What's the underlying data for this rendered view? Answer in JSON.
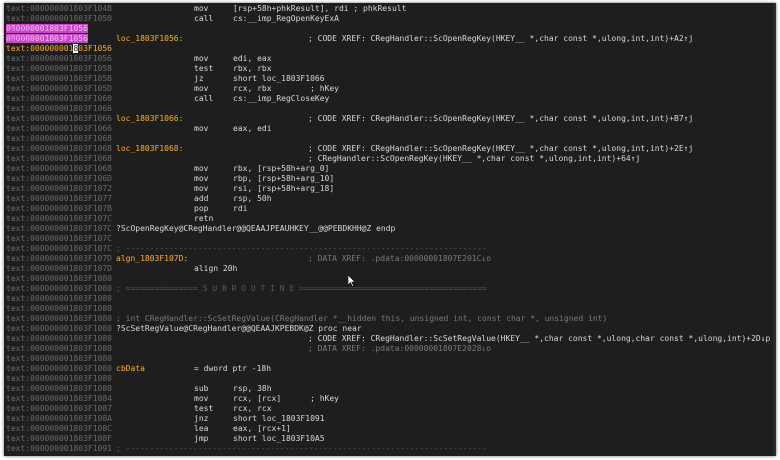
{
  "lines": [
    {
      "addr": "text:000000001803F104B",
      "mnem": "mov",
      "ops": "[rsp+58h+phkResult], rdi ; phkResult"
    },
    {
      "addr": "text:000000001803F1050",
      "mnem": "call",
      "ops": "cs:__imp_RegOpenKeyExA"
    },
    {
      "addr": "text:000000001803F1056",
      "addr_style": "hl"
    },
    {
      "addr": "text:000000001803F1056",
      "addr_style": "hl",
      "label": "loc_1803F1056:",
      "cmt": "; CODE XREF: CRegHandler::ScOpenRegKey(HKEY__ *,char const *,ulong,int,int)+A2↑j"
    },
    {
      "addr": "text:000000001803F1056",
      "addr_style": "sel"
    },
    {
      "addr": "text:000000001803F1056",
      "mnem": "mov",
      "ops": "edi, eax"
    },
    {
      "addr": "text:000000001803F1058",
      "mnem": "test",
      "ops": "rbx, rbx"
    },
    {
      "addr": "text:000000001803F105B",
      "mnem": "jz",
      "ops": "short loc_1803F1066"
    },
    {
      "addr": "text:000000001803F105D",
      "mnem": "mov",
      "ops": "rcx, rbx        ; hKey"
    },
    {
      "addr": "text:000000001803F1060",
      "mnem": "call",
      "ops": "cs:__imp_RegCloseKey"
    },
    {
      "addr": "text:000000001803F1066"
    },
    {
      "addr": "text:000000001803F1066",
      "label": "loc_1803F1066:",
      "cmt": "; CODE XREF: CRegHandler::ScOpenRegKey(HKEY__ *,char const *,ulong,int,int)+B7↑j"
    },
    {
      "addr": "text:000000001803F1066",
      "mnem": "mov",
      "ops": "eax, edi"
    },
    {
      "addr": "text:000000001803F1068"
    },
    {
      "addr": "text:000000001803F1068",
      "label": "loc_1803F1068:",
      "cmt": "; CODE XREF: CRegHandler::ScOpenRegKey(HKEY__ *,char const *,ulong,int,int)+2E↑j"
    },
    {
      "addr": "text:000000001803F1068",
      "cmt": "; CRegHandler::ScOpenRegKey(HKEY__ *,char const *,ulong,int,int)+64↑j"
    },
    {
      "addr": "text:000000001803F1068",
      "mnem": "mov",
      "ops": "rbx, [rsp+58h+arg_0]"
    },
    {
      "addr": "text:000000001803F106D",
      "mnem": "mov",
      "ops": "rbp, [rsp+58h+arg_10]"
    },
    {
      "addr": "text:000000001803F1072",
      "mnem": "mov",
      "ops": "rsi, [rsp+58h+arg_18]"
    },
    {
      "addr": "text:000000001803F1077",
      "mnem": "add",
      "ops": "rsp, 50h"
    },
    {
      "addr": "text:000000001803F107B",
      "mnem": "pop",
      "ops": "rdi"
    },
    {
      "addr": "text:000000001803F107C",
      "mnem": "retn"
    },
    {
      "addr": "text:000000001803F107C",
      "text": "?ScOpenRegKey@CRegHandler@@QEAAJPEAUHKEY__@@PEBDKHH@Z endp"
    },
    {
      "addr": "text:000000001803F107C"
    },
    {
      "addr": "text:000000001803F107C",
      "sep": "; ---------------------------------------------------------------------------"
    },
    {
      "addr": "text:000000001803F107D",
      "label": "algn_1803F107D:",
      "cmt": "; DATA XREF: .pdata:00000001807E201C↓o",
      "cmt_dim": true
    },
    {
      "addr": "text:000000001803F107D",
      "mnem": "align 20h"
    },
    {
      "addr": "text:000000001803F1080"
    },
    {
      "addr": "text:000000001803F1080",
      "sep": "; =============== S U B R O U T I N E ======================================="
    },
    {
      "addr": "text:000000001803F1080"
    },
    {
      "addr": "text:000000001803F1080"
    },
    {
      "addr": "text:000000001803F1080",
      "text": "; int CRegHandler::ScSetRegValue(CRegHandler *__hidden this, unsigned int, const char *, unsigned int)",
      "text_dim": true
    },
    {
      "addr": "text:000000001803F1080",
      "text": "?ScSetRegValue@CRegHandler@@QEAAJKPEBDK@Z proc near"
    },
    {
      "addr": "text:000000001803F1080",
      "cmt": "; CODE XREF: CRegHandler::ScSetRegValue(HKEY__ *,char const *,ulong,char const *,ulong,int)+2D↓p"
    },
    {
      "addr": "text:000000001803F1080",
      "cmt": "; DATA XREF: .pdata:00000001807E2028↓o",
      "cmt_dim": true
    },
    {
      "addr": "text:000000001803F1080"
    },
    {
      "addr": "text:000000001803F1080",
      "label": "cbData",
      "mnem": "= dword ptr -18h"
    },
    {
      "addr": "text:000000001803F1080"
    },
    {
      "addr": "text:000000001803F1080",
      "mnem": "sub",
      "ops": "rsp, 38h"
    },
    {
      "addr": "text:000000001803F1084",
      "mnem": "mov",
      "ops": "rcx, [rcx]      ; hKey"
    },
    {
      "addr": "text:000000001803F1087",
      "mnem": "test",
      "ops": "rcx, rcx"
    },
    {
      "addr": "text:000000001803F108A",
      "mnem": "jnz",
      "ops": "short loc_1803F1091"
    },
    {
      "addr": "text:000000001803F108C",
      "mnem": "lea",
      "ops": "eax, [rcx+1]"
    },
    {
      "addr": "text:000000001803F108F",
      "mnem": "jmp",
      "ops": "short loc_1803F10A5"
    },
    {
      "addr": "text:000000001803F1091",
      "sep": "; ---------------------------------------------------------------------------"
    }
  ]
}
